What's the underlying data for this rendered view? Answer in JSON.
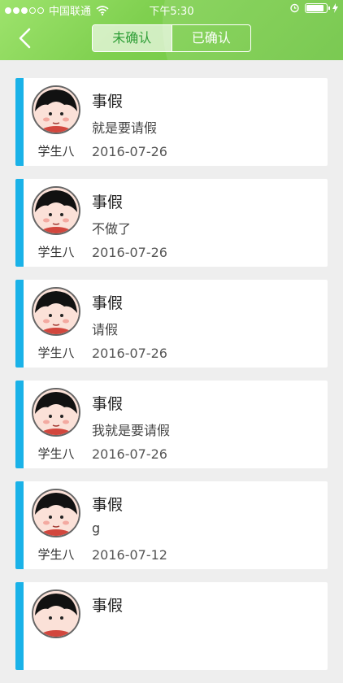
{
  "status_bar": {
    "carrier": "中国联通",
    "time": "下午5:30"
  },
  "tabs": [
    {
      "label": "未确认",
      "active": true
    },
    {
      "label": "已确认",
      "active": false
    }
  ],
  "items": [
    {
      "name": "学生八",
      "type": "事假",
      "reason": "就是要请假",
      "date": "2016-07-26"
    },
    {
      "name": "学生八",
      "type": "事假",
      "reason": "不做了",
      "date": "2016-07-26"
    },
    {
      "name": "学生八",
      "type": "事假",
      "reason": "请假",
      "date": "2016-07-26"
    },
    {
      "name": "学生八",
      "type": "事假",
      "reason": "我就是要请假",
      "date": "2016-07-26"
    },
    {
      "name": "学生八",
      "type": "事假",
      "reason": "g",
      "date": "2016-07-12"
    },
    {
      "name": "",
      "type": "事假",
      "reason": "",
      "date": ""
    }
  ],
  "colors": {
    "header": "#7fd04f",
    "card_accent": "#1ab2e8",
    "background": "#eeeeee"
  }
}
